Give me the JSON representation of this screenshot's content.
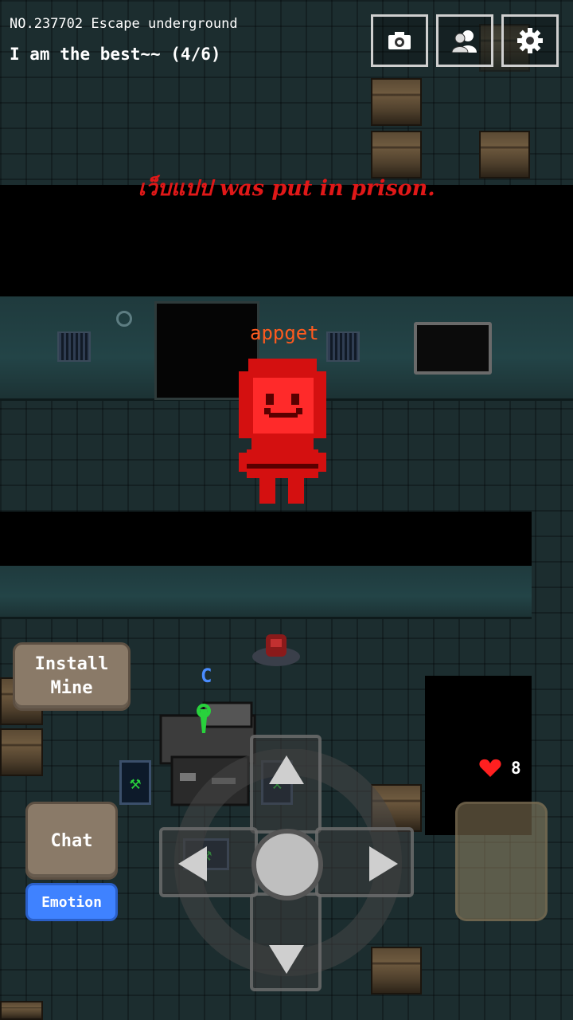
{
  "hud": {
    "room_line": "NO.237702 Escape underground",
    "status_line": "I am the best~~ (4/6)"
  },
  "top_buttons": [
    {
      "icon": "camera-icon"
    },
    {
      "icon": "friends-icon"
    },
    {
      "icon": "gear-icon"
    }
  ],
  "event_message": "เว็บแปป was put in prison.",
  "player": {
    "name": "appget"
  },
  "other_player_letter": "C",
  "controls": {
    "install_mine_label": "Install\nMine",
    "chat_label": "Chat",
    "emotion_label": "Emotion"
  },
  "health": {
    "icon": "heart-icon",
    "value": "8"
  },
  "colors": {
    "message": "#e01818",
    "player_name": "#ff5a1e",
    "emotion_button": "#3f82ff"
  }
}
